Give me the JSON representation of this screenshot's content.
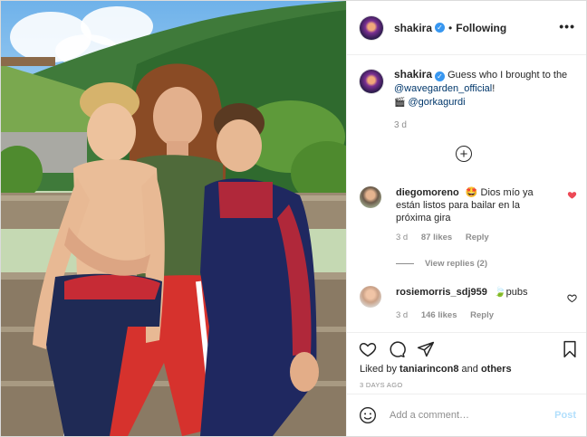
{
  "header": {
    "username": "shakira",
    "verified_glyph": "✓",
    "separator": "•",
    "follow_status": "Following",
    "more_glyph": "•••"
  },
  "caption": {
    "username": "shakira",
    "text": "Guess who I brought to the",
    "mention1": "@wavegarden_official",
    "mention1_suffix": "!",
    "clapper_emoji": "🎬",
    "mention2": "@gorkagurdi",
    "time": "3 d"
  },
  "load_more_glyph": "+",
  "comments": [
    {
      "username": "diegomoreno",
      "emoji": "🤩",
      "text": "Dios mío ya están listos para bailar en la próxima gira",
      "time": "3 d",
      "likes": "87 likes",
      "reply": "Reply",
      "liked": true
    },
    {
      "username": "rosiemorris_sdj959",
      "emoji": "🍃",
      "text": "pubs",
      "time": "3 d",
      "likes": "146 likes",
      "reply": "Reply",
      "liked": false
    }
  ],
  "view_replies": "View replies (2)",
  "actions": {
    "liked_by_prefix": "Liked by",
    "liked_by_user": "taniarincon8",
    "liked_by_suffix": "and",
    "liked_by_others": "others",
    "timestamp": "3 DAYS AGO"
  },
  "add_comment": {
    "placeholder": "Add a comment…",
    "post_label": "Post"
  },
  "colors": {
    "link": "#00376b",
    "verified": "#3897f0",
    "heart": "#ed4956",
    "post_disabled": "#b2dffc"
  }
}
